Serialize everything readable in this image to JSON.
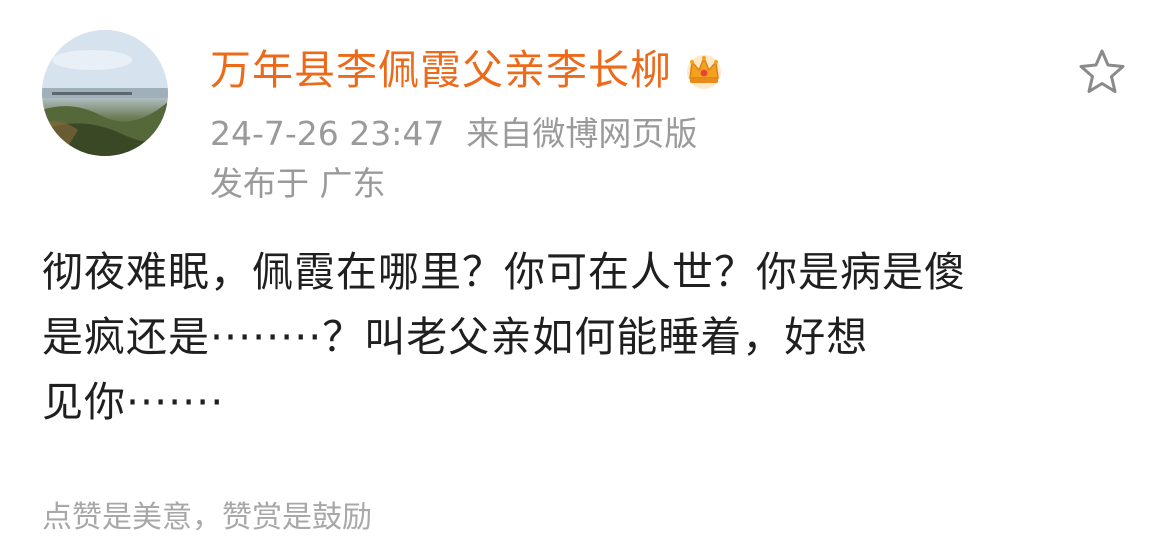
{
  "author": {
    "name": "万年县李佩霞父亲李长柳",
    "avatar_icon": "avatar-landscape",
    "badge_icon": "crown-icon",
    "name_color": "#ec6a19"
  },
  "meta": {
    "timestamp": "24-7-26 23:47",
    "source": "来自微博网页版",
    "location": "发布于 广东"
  },
  "actions": {
    "favorite_icon": "star-icon"
  },
  "post": {
    "lines": [
      "彻夜难眠，佩霞在哪里？你可在人世？你是病是傻",
      "是疯还是········？叫老父亲如何能睡着，好想",
      "见你·······"
    ]
  },
  "footer": {
    "note": "点赞是美意，赞赏是鼓励"
  }
}
